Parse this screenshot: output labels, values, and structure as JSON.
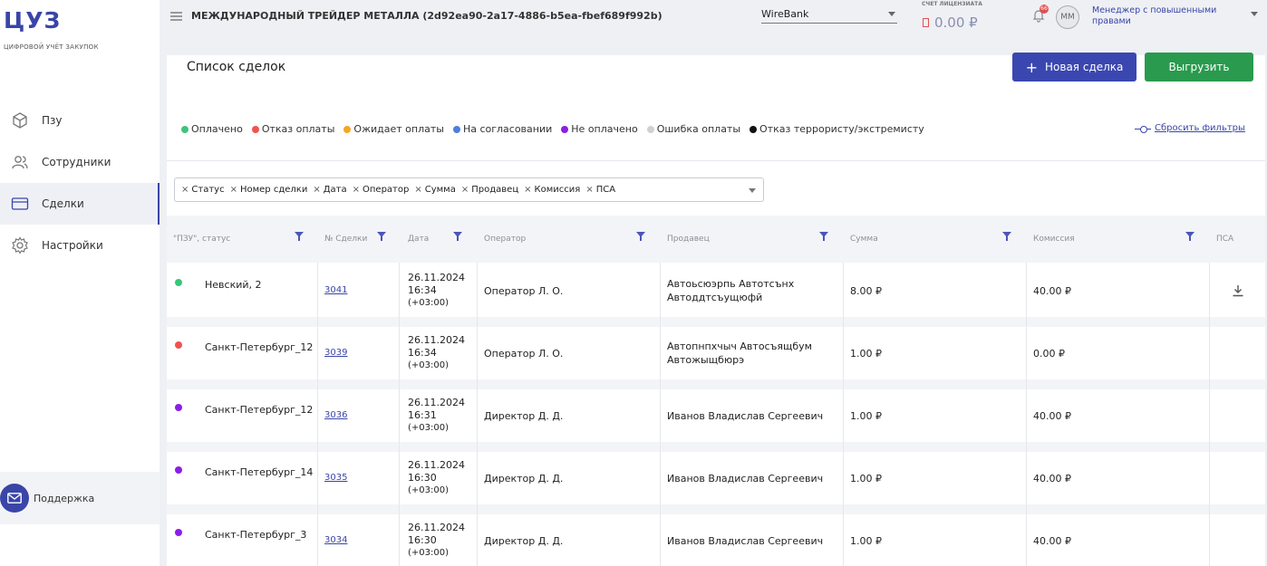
{
  "app": {
    "logo": "ЦУЗ",
    "logo_subtitle": "ЦИФРОВОЙ УЧЁТ ЗАКУПОК"
  },
  "sidebar": {
    "items": [
      {
        "label": "Пзу",
        "icon": "cube-icon",
        "active": false
      },
      {
        "label": "Сотрудники",
        "icon": "users-icon",
        "active": false
      },
      {
        "label": "Сделки",
        "icon": "card-icon",
        "active": true
      },
      {
        "label": "Настройки",
        "icon": "gear-icon",
        "active": false
      }
    ],
    "support_label": "Поддержка"
  },
  "header": {
    "company": "МЕЖДУНАРОДНЫЙ ТРЕЙДЕР МЕТАЛЛА (2d92ea90-2a17-4886-b5ea-fbef689f992b)",
    "bank": "WireBank",
    "account_label": "СЧЕТ ЛИЦЕНЗИАТА",
    "account_value": "0.00 ₽",
    "notifications_count": "66",
    "avatar_initials": "ММ",
    "role": "Менеджер с повышенными правами"
  },
  "page": {
    "title": "Список сделок",
    "new_deal_label": "Новая сделка",
    "export_label": "Выгрузить",
    "reset_filters_label": "Сбросить фильтры"
  },
  "legend": [
    {
      "label": "Оплачено",
      "color": "#3cc47c"
    },
    {
      "label": "Отказ оплаты",
      "color": "#ef5350"
    },
    {
      "label": "Ожидает оплаты",
      "color": "#f5a623"
    },
    {
      "label": "На согласовании",
      "color": "#4a7fe0"
    },
    {
      "label": "Не оплачено",
      "color": "#8b1ee6"
    },
    {
      "label": "Ошибка оплаты",
      "color": "#d0d0d0"
    },
    {
      "label": "Отказ террористу/экстремисту",
      "color": "#111111"
    }
  ],
  "filter_chips": [
    "Статус",
    "Номер сделки",
    "Дата",
    "Оператор",
    "Сумма",
    "Продавец",
    "Комиссия",
    "ПСА"
  ],
  "table": {
    "headers": [
      "\"ПЗУ\", статус",
      "№ Сделки",
      "Дата",
      "Оператор",
      "Продавец",
      "Сумма",
      "Комиссия",
      "ПСА"
    ],
    "rows": [
      {
        "status_color": "#3cc47c",
        "pzu": "Невский, 2",
        "deal": "3041",
        "date": "26.11.2024",
        "time": "16:34",
        "tz": "(+03:00)",
        "operator": "Оператор Л. О.",
        "seller_1": "Автоьсюэрпь Автотсънх",
        "seller_2": "Автоддтсъущюфй",
        "sum": "8.00 ₽",
        "commission": "40.00 ₽",
        "psa": true
      },
      {
        "status_color": "#ef5350",
        "pzu": "Санкт-Петербург_12",
        "deal": "3039",
        "date": "26.11.2024",
        "time": "16:34",
        "tz": "(+03:00)",
        "operator": "Оператор Л. О.",
        "seller_1": "Автопнпхчыч Автосъящбум",
        "seller_2": "Автожыщбюрэ",
        "sum": "1.00 ₽",
        "commission": "0.00 ₽",
        "psa": false
      },
      {
        "status_color": "#8b1ee6",
        "pzu": "Санкт-Петербург_12",
        "deal": "3036",
        "date": "26.11.2024",
        "time": "16:31",
        "tz": "(+03:00)",
        "operator": "Директор Д. Д.",
        "seller_1": "Иванов Владислав Сергеевич",
        "seller_2": "",
        "sum": "1.00 ₽",
        "commission": "40.00 ₽",
        "psa": false
      },
      {
        "status_color": "#8b1ee6",
        "pzu": "Санкт-Петербург_14",
        "deal": "3035",
        "date": "26.11.2024",
        "time": "16:30",
        "tz": "(+03:00)",
        "operator": "Директор Д. Д.",
        "seller_1": "Иванов Владислав Сергеевич",
        "seller_2": "",
        "sum": "1.00 ₽",
        "commission": "40.00 ₽",
        "psa": false
      },
      {
        "status_color": "#8b1ee6",
        "pzu": "Санкт-Петербург_3",
        "deal": "3034",
        "date": "26.11.2024",
        "time": "16:30",
        "tz": "(+03:00)",
        "operator": "Директор Д. Д.",
        "seller_1": "Иванов Владислав Сергеевич",
        "seller_2": "",
        "sum": "1.00 ₽",
        "commission": "40.00 ₽",
        "psa": false
      }
    ]
  }
}
